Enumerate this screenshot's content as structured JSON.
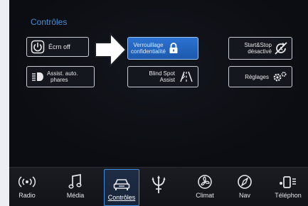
{
  "section_title": "Contrôles",
  "buttons": {
    "screen_off": "Écrn off",
    "privacy_lock_line1": "Verrouillage",
    "privacy_lock_line2": "confidentialité",
    "start_stop_line1": "Start&Stop",
    "start_stop_line2": "désactivé",
    "auto_headlights_line1": "Assist. auto.",
    "auto_headlights_line2": "phares",
    "blind_spot_line1": "Blind Spot",
    "blind_spot_line2": "Assist",
    "settings": "Réglages"
  },
  "nav": {
    "radio": "Radio",
    "media": "Média",
    "controls": "Contrôles",
    "climate": "Climat",
    "nav": "Nav",
    "phone": "Téléphon"
  },
  "icons": {
    "screen_off": "power-icon",
    "privacy_lock": "padlock-icon",
    "start_stop": "start-stop-off-icon",
    "auto_headlights": "headlight-icon",
    "blind_spot": "blind-spot-icon",
    "settings": "gears-icon",
    "radio": "radio-waves-icon",
    "media": "music-note-icon",
    "controls": "car-icon",
    "home": "trident-logo",
    "climate": "fan-icon",
    "nav": "compass-icon",
    "phone": "phone-icon"
  },
  "colors": {
    "accent_blue": "#2b73d2",
    "title_blue": "#3f8fd6",
    "background": "#0b0d12"
  }
}
